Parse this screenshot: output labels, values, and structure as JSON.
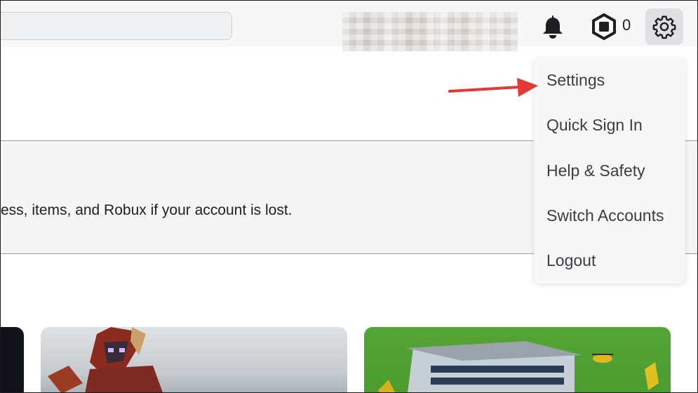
{
  "header": {
    "search": {
      "value": "",
      "placeholder": ""
    },
    "robux_count": "0"
  },
  "banner": {
    "text": "ess, items, and Robux if your account is lost."
  },
  "menu": {
    "items": [
      {
        "label": "Settings"
      },
      {
        "label": "Quick Sign In"
      },
      {
        "label": "Help & Safety"
      },
      {
        "label": "Switch Accounts"
      },
      {
        "label": "Logout"
      }
    ]
  },
  "colors": {
    "header_bg": "#f7f7f8",
    "menu_bg": "#f7f7f8",
    "arrow": "#e53935",
    "gear_button_bg": "#dfe0e3"
  },
  "icons": [
    "bell-icon",
    "robux-icon",
    "gear-icon"
  ]
}
